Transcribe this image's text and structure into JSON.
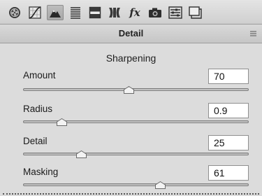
{
  "toolbar": {
    "tools": [
      {
        "icon": "aperture-icon"
      },
      {
        "icon": "tone-curve-icon"
      },
      {
        "icon": "sharpen-icon",
        "active": true
      },
      {
        "icon": "hsl-icon"
      },
      {
        "icon": "split-toning-icon"
      },
      {
        "icon": "lens-corrections-icon"
      },
      {
        "icon": "effects-fx-icon",
        "text": "fx"
      },
      {
        "icon": "camera-calibration-icon"
      },
      {
        "icon": "presets-icon"
      },
      {
        "icon": "snapshots-icon"
      }
    ]
  },
  "header": {
    "title": "Detail",
    "menu_icon": "panel-menu-icon"
  },
  "section": {
    "title": "Sharpening"
  },
  "controls": [
    {
      "label": "Amount",
      "value": "70",
      "min": 0,
      "max": 150,
      "level": 70
    },
    {
      "label": "Radius",
      "value": "0.9",
      "min": 0.5,
      "max": 3.0,
      "level": 0.9
    },
    {
      "label": "Detail",
      "value": "25",
      "min": 0,
      "max": 100,
      "level": 25
    },
    {
      "label": "Masking",
      "value": "61",
      "min": 0,
      "max": 100,
      "level": 61
    }
  ],
  "colors": {
    "panel_bg": "#dcdcdc",
    "field_bg": "#ffffff",
    "active_tool": "#b0b0b0"
  }
}
